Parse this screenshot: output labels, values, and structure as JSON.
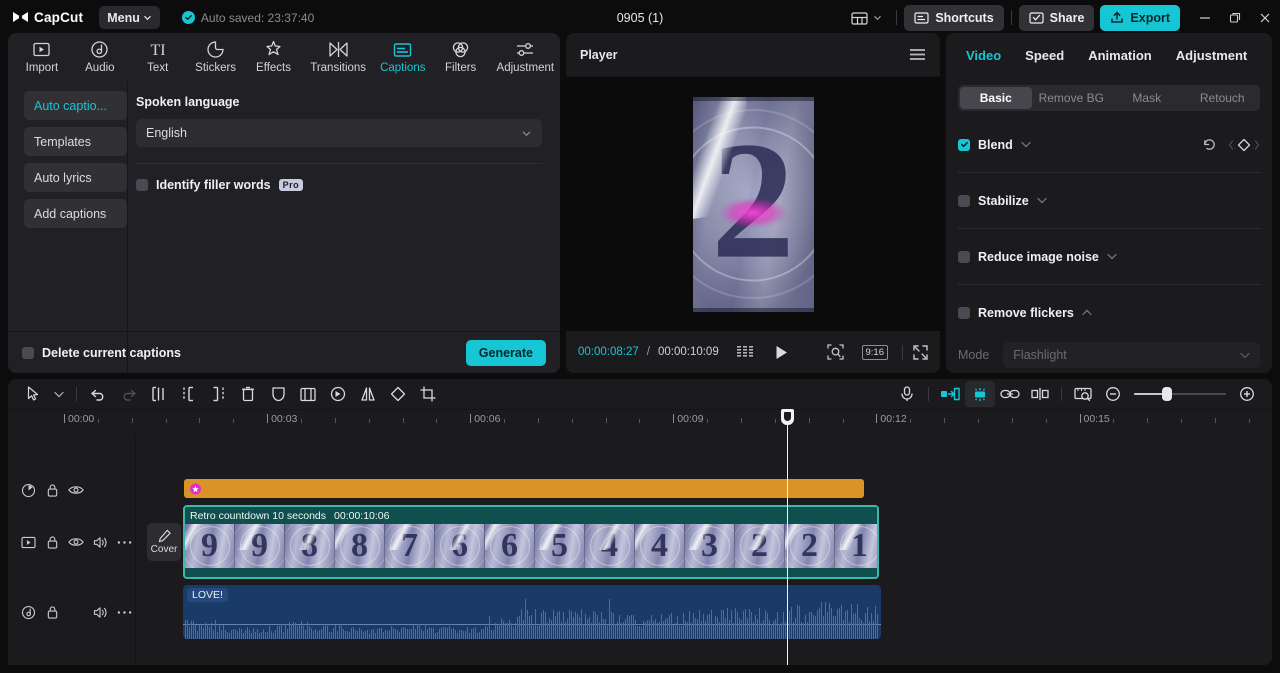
{
  "titlebar": {
    "brand": "CapCut",
    "menu_label": "Menu",
    "autosave_text": "Auto saved: 23:37:40",
    "doc_title": "0905 (1)",
    "shortcuts_label": "Shortcuts",
    "share_label": "Share",
    "export_label": "Export",
    "layout_icon": "layout-icon",
    "minimize_icon": "minimize-icon",
    "maximize_icon": "maximize-icon",
    "close_icon": "close-icon"
  },
  "tabs": [
    {
      "label": "Import",
      "icon": "import-icon",
      "active": false
    },
    {
      "label": "Audio",
      "icon": "audio-icon",
      "active": false
    },
    {
      "label": "Text",
      "icon": "text-icon",
      "active": false
    },
    {
      "label": "Stickers",
      "icon": "stickers-icon",
      "active": false
    },
    {
      "label": "Effects",
      "icon": "effects-icon",
      "active": false
    },
    {
      "label": "Transitions",
      "icon": "transitions-icon",
      "active": false
    },
    {
      "label": "Captions",
      "icon": "captions-icon",
      "active": true
    },
    {
      "label": "Filters",
      "icon": "filters-icon",
      "active": false
    },
    {
      "label": "Adjustment",
      "icon": "adjustment-icon",
      "active": false
    }
  ],
  "subnav": [
    {
      "label": "Auto captio...",
      "active": true
    },
    {
      "label": "Templates",
      "active": false
    },
    {
      "label": "Auto lyrics",
      "active": false
    },
    {
      "label": "Add captions",
      "active": false
    }
  ],
  "captions_panel": {
    "spoken_language_label": "Spoken language",
    "language_value": "English",
    "language_options": [
      "English"
    ],
    "filler_words_label": "Identify filler words",
    "filler_words_badge": "Pro",
    "filler_words_checked": false,
    "delete_captions_label": "Delete current captions",
    "delete_captions_checked": false,
    "generate_label": "Generate"
  },
  "player": {
    "title": "Player",
    "menu_icon": "hamburger-icon",
    "current_time": "00:00:08:27",
    "separator": "/",
    "total_time": "00:00:10:09",
    "frames_icon": "frames-icon",
    "play_icon": "play-icon",
    "crop_icon": "zoom-selection-icon",
    "aspect_ratio": "9:16",
    "fullscreen_icon": "fullscreen-icon",
    "preview_number": "2"
  },
  "right_panel": {
    "tabs": [
      {
        "label": "Video",
        "active": true
      },
      {
        "label": "Speed",
        "active": false
      },
      {
        "label": "Animation",
        "active": false
      },
      {
        "label": "Adjustment",
        "active": false
      }
    ],
    "subtabs": [
      {
        "label": "Basic",
        "active": true,
        "enabled": true
      },
      {
        "label": "Remove BG",
        "active": false,
        "enabled": false
      },
      {
        "label": "Mask",
        "active": false,
        "enabled": false
      },
      {
        "label": "Retouch",
        "active": false,
        "enabled": false
      }
    ],
    "options": [
      {
        "label": "Blend",
        "checked": true,
        "caret": "down",
        "has_reset": true,
        "has_keyframe": true
      },
      {
        "label": "Stabilize",
        "checked": false,
        "caret": "down",
        "has_reset": false,
        "has_keyframe": false
      },
      {
        "label": "Reduce image noise",
        "checked": false,
        "caret": "down",
        "has_reset": false,
        "has_keyframe": false
      },
      {
        "label": "Remove flickers",
        "checked": false,
        "caret": "up",
        "has_reset": false,
        "has_keyframe": false
      }
    ],
    "mode_label": "Mode",
    "mode_value": "Flashlight"
  },
  "timeline": {
    "tools": [
      {
        "name": "select-cursor-icon",
        "state": "normal"
      },
      {
        "name": "cursor-dropdown-icon",
        "state": "normal"
      },
      {
        "name": "undo-icon",
        "state": "normal"
      },
      {
        "name": "redo-icon",
        "state": "disabled"
      },
      {
        "name": "split-icon",
        "state": "normal"
      },
      {
        "name": "trim-left-icon",
        "state": "normal"
      },
      {
        "name": "trim-right-icon",
        "state": "normal"
      },
      {
        "name": "delete-icon",
        "state": "normal"
      },
      {
        "name": "mask-icon",
        "state": "normal"
      },
      {
        "name": "freeze-frame-icon",
        "state": "normal"
      },
      {
        "name": "reverse-icon",
        "state": "normal"
      },
      {
        "name": "mirror-icon",
        "state": "normal"
      },
      {
        "name": "rotate-icon",
        "state": "normal"
      },
      {
        "name": "crop-icon",
        "state": "normal"
      }
    ],
    "right_tools": [
      {
        "name": "record-voiceover-icon",
        "state": "normal"
      },
      {
        "name": "snap-to-clip-icon",
        "state": "active"
      },
      {
        "name": "magnet-icon",
        "state": "active-bg"
      },
      {
        "name": "link-clips-icon",
        "state": "normal"
      },
      {
        "name": "split-sync-icon",
        "state": "normal"
      },
      {
        "name": "preview-thumbnail-icon",
        "state": "normal"
      },
      {
        "name": "zoom-out-icon",
        "state": "normal"
      },
      {
        "name": "zoom-in-icon",
        "state": "normal"
      }
    ],
    "ruler_labels": [
      "00:00",
      "00:03",
      "00:06",
      "00:09",
      "00:12",
      "00:15"
    ],
    "playhead_time": "00:09",
    "cover_label": "Cover",
    "track_headers": [
      {
        "track": "effect",
        "icons": [
          "effect-clock-icon",
          "lock-icon",
          "eye-icon"
        ]
      },
      {
        "track": "video",
        "icons": [
          "video-icon",
          "lock-icon",
          "eye-icon",
          "volume-icon",
          "more-icon"
        ]
      },
      {
        "track": "audio",
        "icons": [
          "audio-note-icon",
          "lock-icon",
          "volume-icon",
          "more-icon"
        ]
      }
    ],
    "clips": {
      "effect": {
        "name": "effect-clip",
        "color": "#d99327"
      },
      "video": {
        "name": "Retro countdown 10 seconds",
        "duration": "00:00:10:06",
        "color": "#0f4f4e",
        "border_color": "#3fb6ad",
        "thumbnails": [
          "9",
          "9",
          "8",
          "8",
          "7",
          "6",
          "6",
          "5",
          "4",
          "4",
          "3",
          "2",
          "2",
          "1"
        ]
      },
      "audio": {
        "name": "LOVE!",
        "color": "#1a3a68"
      }
    }
  }
}
